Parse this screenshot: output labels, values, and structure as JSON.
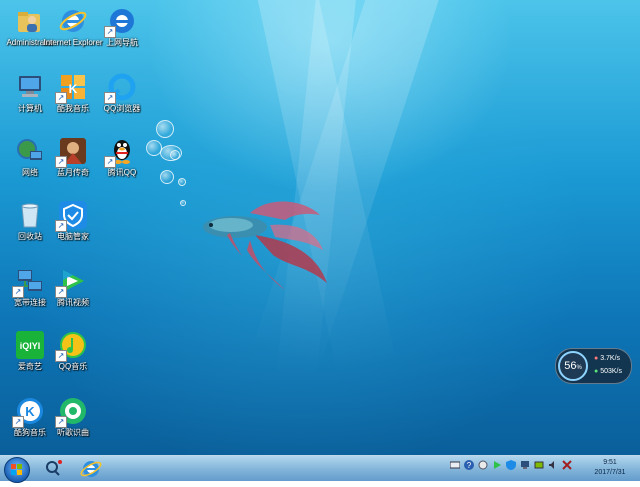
{
  "desktop": {
    "icons": [
      {
        "label": "Administrator",
        "icon": "user-folder-icon",
        "shortcut": false
      },
      {
        "label": "Internet Explorer",
        "icon": "internet-explorer-icon",
        "shortcut": false
      },
      {
        "label": "上网导航",
        "icon": "edge-browser-icon",
        "shortcut": true
      },
      {
        "label": "计算机",
        "icon": "computer-icon",
        "shortcut": false
      },
      {
        "label": "酷我音乐",
        "icon": "kuwo-music-icon",
        "shortcut": true
      },
      {
        "label": "QQ浏览器",
        "icon": "qq-browser-icon",
        "shortcut": true
      },
      {
        "label": "网络",
        "icon": "network-icon",
        "shortcut": false
      },
      {
        "label": "蓝月传奇",
        "icon": "game-icon",
        "shortcut": true
      },
      {
        "label": "腾讯QQ",
        "icon": "qq-penguin-icon",
        "shortcut": true
      },
      {
        "label": "回收站",
        "icon": "recycle-bin-icon",
        "shortcut": false
      },
      {
        "label": "电脑管家",
        "icon": "pc-manager-shield-icon",
        "shortcut": true
      },
      {
        "label": "宽带连接",
        "icon": "broadband-connection-icon",
        "shortcut": true
      },
      {
        "label": "腾讯视频",
        "icon": "tencent-video-icon",
        "shortcut": true
      },
      {
        "label": "爱奇艺",
        "icon": "iqiyi-icon",
        "shortcut": false
      },
      {
        "label": "QQ音乐",
        "icon": "qq-music-icon",
        "shortcut": true
      },
      {
        "label": "酷狗音乐",
        "icon": "kugou-music-icon",
        "shortcut": true
      },
      {
        "label": "听歌识曲",
        "icon": "song-recognition-icon",
        "shortcut": true
      }
    ]
  },
  "widget": {
    "percent": "56",
    "percent_unit": "%",
    "upload": "3.7K/s",
    "download": "503K/s"
  },
  "taskbar": {
    "start_icon": "windows-logo-icon",
    "pinned": [
      {
        "icon": "qq-browser-search-icon"
      },
      {
        "icon": "internet-explorer-icon"
      }
    ],
    "tray_icons": [
      "keyboard-icon",
      "help-icon",
      "settings-icon",
      "media-player-icon",
      "shield-icon",
      "network-status-icon",
      "battery-icon",
      "volume-icon",
      "close-icon"
    ],
    "clock": {
      "time": "9:51",
      "date": "2017/7/31"
    }
  }
}
